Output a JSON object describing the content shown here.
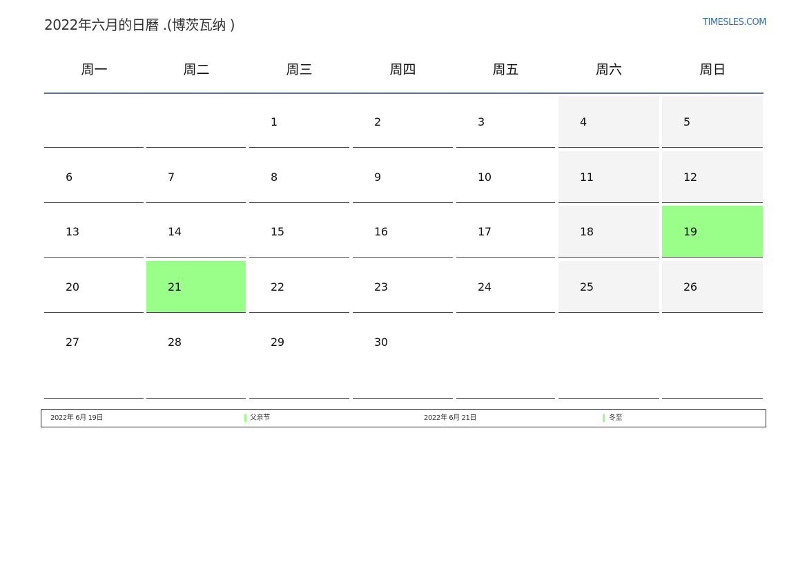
{
  "header": {
    "title": "2022年六月的日曆 .(博茨瓦纳 )",
    "brand": "TIMESLES.COM"
  },
  "weekdays": [
    "周一",
    "周二",
    "周三",
    "周四",
    "周五",
    "周六",
    "周日"
  ],
  "weeks": [
    [
      "",
      "",
      "1",
      "2",
      "3",
      "4",
      "5"
    ],
    [
      "6",
      "7",
      "8",
      "9",
      "10",
      "11",
      "12"
    ],
    [
      "13",
      "14",
      "15",
      "16",
      "17",
      "18",
      "19"
    ],
    [
      "20",
      "21",
      "22",
      "23",
      "24",
      "25",
      "26"
    ],
    [
      "27",
      "28",
      "29",
      "30",
      "",
      "",
      ""
    ]
  ],
  "holidays": [
    {
      "date": "2022年 6月 19日",
      "name": "父亲节",
      "day": "19"
    },
    {
      "date": "2022年 6月 21日",
      "name": "冬至",
      "day": "21"
    }
  ],
  "colors": {
    "holiday": "#99ff88",
    "weekend": "#f4f4f4",
    "header_rule": "#5b7391",
    "brand": "#2f6db3"
  }
}
